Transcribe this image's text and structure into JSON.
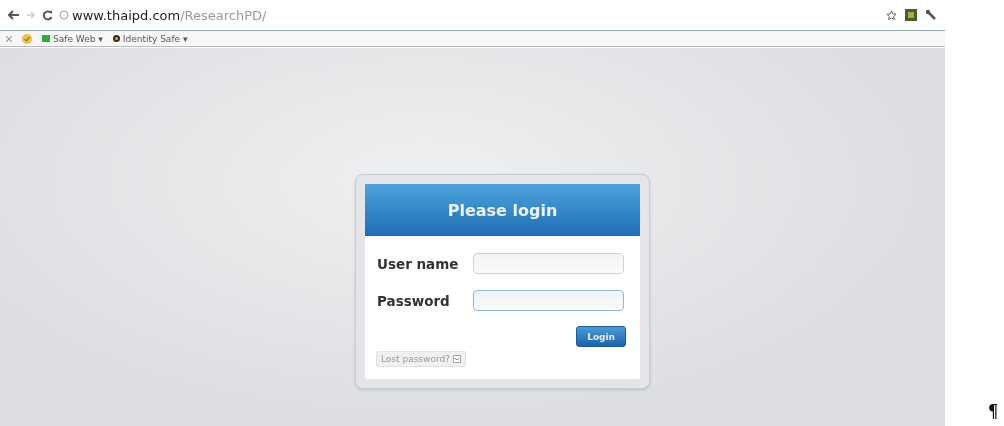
{
  "browser": {
    "url_host": "www.thaipd.com",
    "url_path": "/ResearchPD/",
    "bookmarks": [
      {
        "kind": "menu",
        "label": "Safe Web ▾"
      },
      {
        "kind": "menu",
        "label": "Identity Safe ▾"
      }
    ]
  },
  "login": {
    "title": "Please login",
    "fields": [
      {
        "label": "User name",
        "focused": false
      },
      {
        "label": "Password",
        "focused": true
      }
    ],
    "button": "Login",
    "lost_password": "Lost password?"
  },
  "paragraph_mark": "¶"
}
